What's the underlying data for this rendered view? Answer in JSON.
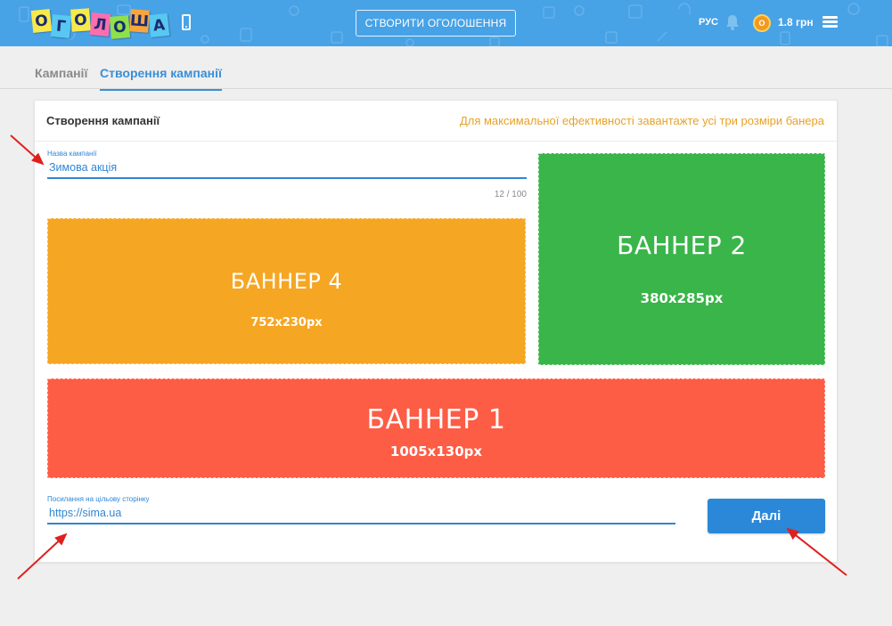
{
  "header": {
    "logo_letters": [
      "О",
      "Г",
      "О",
      "Л",
      "О",
      "Ш",
      "А"
    ],
    "logo_colors": [
      "#f7e94a",
      "#57c8f2",
      "#f7e94a",
      "#fb6fae",
      "#8fe04a",
      "#f9a53b",
      "#57c8f2"
    ],
    "create_ad_label": "СТВОРИТИ ОГОЛОШЕННЯ",
    "language": "РУС",
    "coin_symbol": "О",
    "balance": "1.8 грн",
    "background_color": "#48a2e6"
  },
  "tabs": [
    {
      "label": "Кампанії",
      "active": false
    },
    {
      "label": "Створення кампанії",
      "active": true
    }
  ],
  "card": {
    "title": "Створення кампанії",
    "hint": "Для максимальної ефективності завантажте усі три розміри банера"
  },
  "campaign_name": {
    "label": "Назва кампанії",
    "value": "Зимова акція",
    "counter": "12 / 100"
  },
  "banners": {
    "banner4": {
      "title": "БАННЕР 4",
      "size": "752x230px",
      "color": "#f5a623"
    },
    "banner2": {
      "title": "БАННЕР 2",
      "size": "380x285px",
      "color": "#39b54a"
    },
    "banner1": {
      "title": "БАННЕР 1",
      "size": "1005x130px",
      "color": "#fd5c45"
    }
  },
  "target_url": {
    "label": "Посилання на цільову сторінку",
    "value": "https://sima.ua"
  },
  "next_button": "Далі",
  "colors": {
    "accent": "#2f86d6",
    "hint": "#e6a22a",
    "annotation_arrow": "#e0201e"
  }
}
